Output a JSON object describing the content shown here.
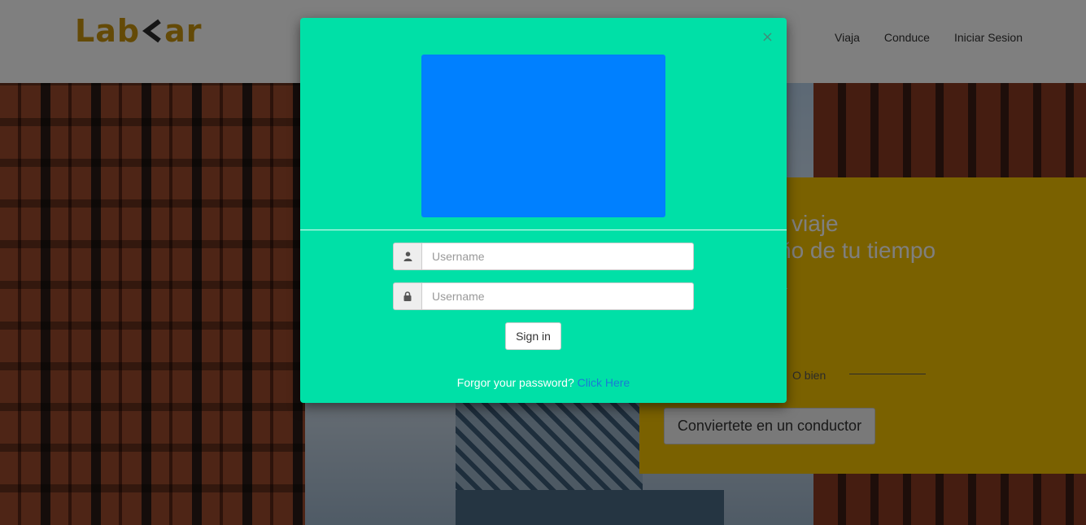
{
  "brand": {
    "logo_prefix": "Lab",
    "logo_suffix": "ar",
    "color": "#c9950f"
  },
  "nav": {
    "items": [
      {
        "label": "Viaja"
      },
      {
        "label": "Conduce"
      },
      {
        "label": "Iniciar Sesion"
      }
    ]
  },
  "promo": {
    "headline": "Tu viaje\ndueño de tu tiempo",
    "headline_line1": "viaje",
    "headline_line2": "ño de tu tiempo",
    "divider_text": "O bien",
    "cta_label": "Conviertete en un conductor",
    "background": "#f5c200"
  },
  "modal": {
    "background": "#00e0a7",
    "image_color": "#0080ff",
    "close_symbol": "×",
    "username_placeholder": "Username",
    "password_placeholder": "Username",
    "username_icon": "user-icon",
    "password_icon": "lock-icon",
    "signin_label": "Sign in",
    "forgot_text": "Forgor your password?",
    "forgot_link": "Click Here"
  }
}
